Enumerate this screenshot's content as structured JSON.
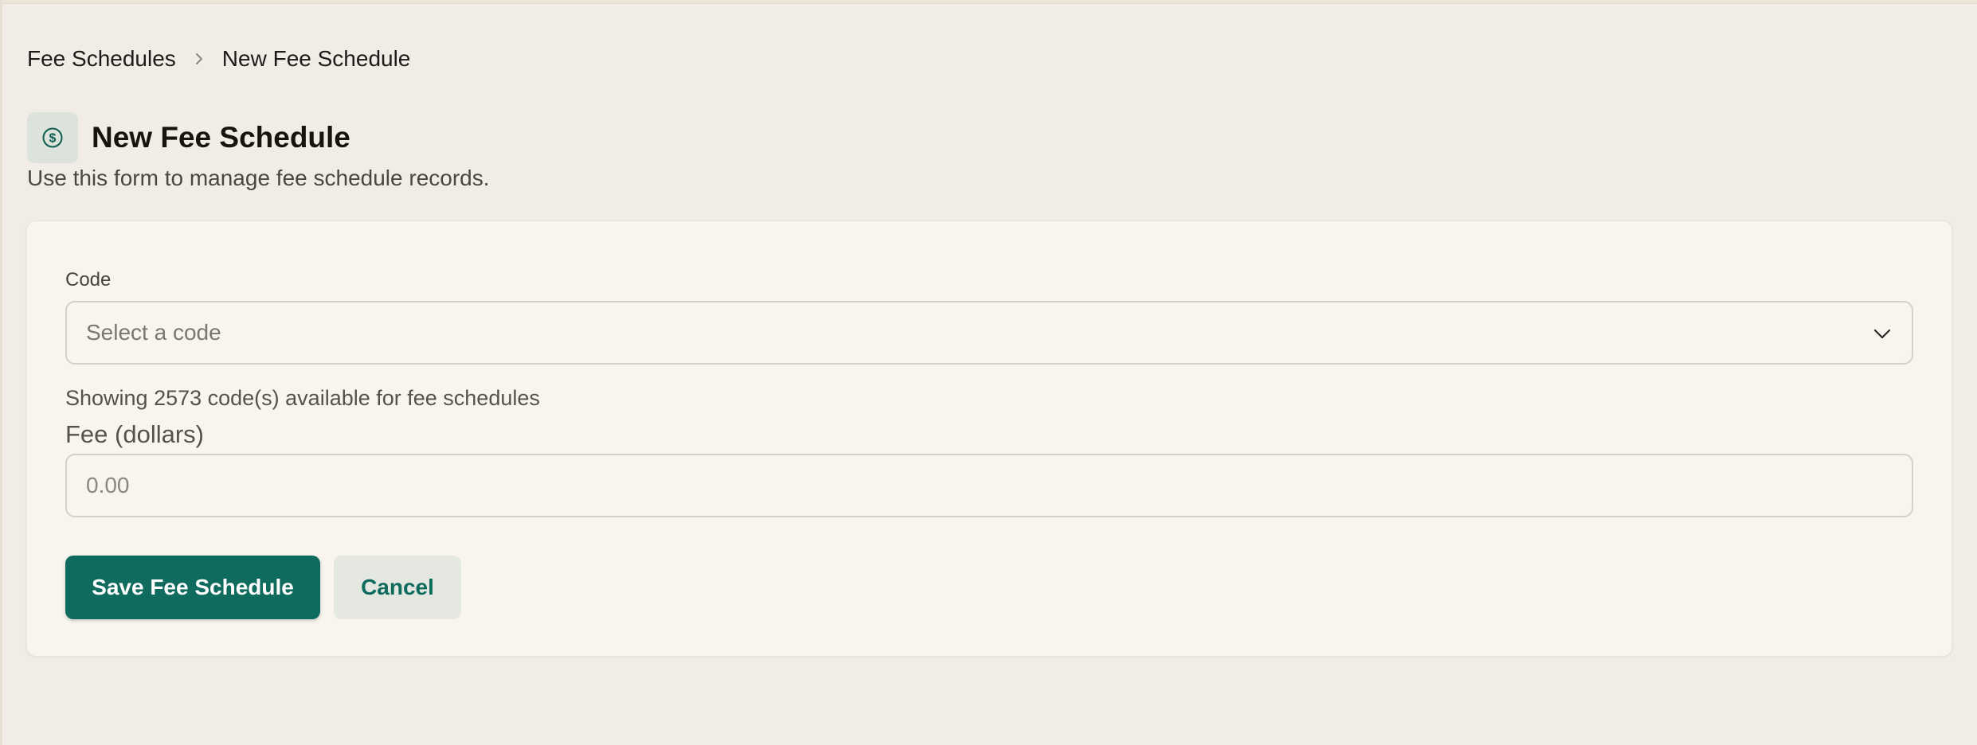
{
  "breadcrumb": {
    "parent": "Fee Schedules",
    "current": "New Fee Schedule"
  },
  "header": {
    "icon": "dollar-circle-icon",
    "title": "New Fee Schedule",
    "subtitle": "Use this form to manage fee schedule records."
  },
  "form": {
    "code": {
      "label": "Code",
      "placeholder": "Select a code",
      "help_text": "Showing 2573 code(s) available for fee schedules"
    },
    "fee": {
      "label": "Fee (dollars)",
      "placeholder": "0.00"
    },
    "actions": {
      "save_label": "Save Fee Schedule",
      "cancel_label": "Cancel"
    }
  },
  "colors": {
    "page_background": "#f1ede6",
    "card_background": "#f8f4ee",
    "accent": "#0f6b5d",
    "icon_background": "#dbe3dc",
    "secondary_button": "#e4e8e0"
  }
}
